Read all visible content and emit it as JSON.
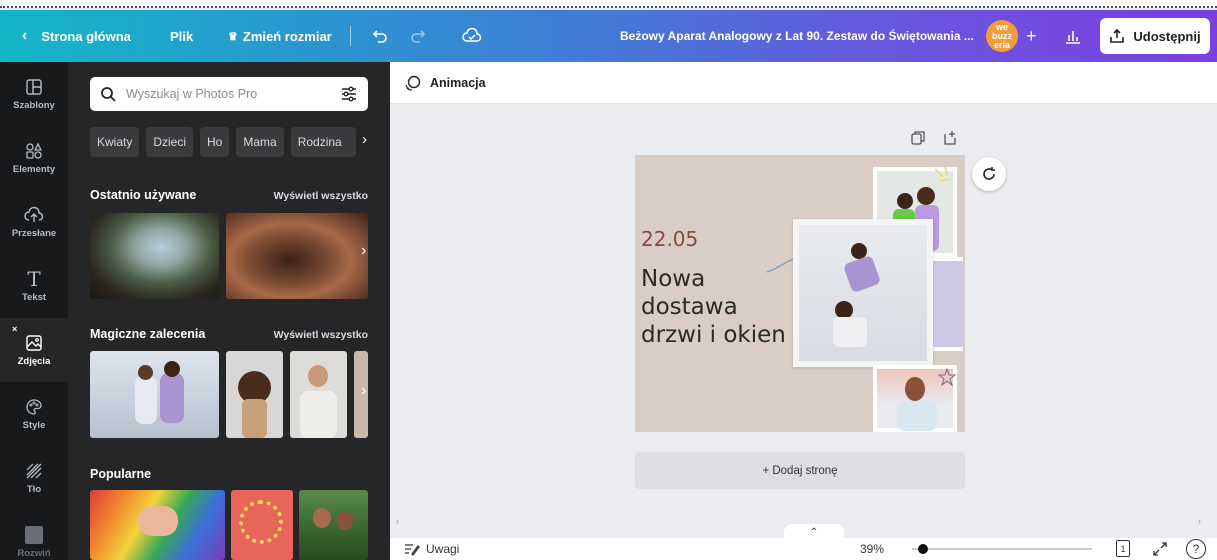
{
  "topbar": {
    "home_label": "Strona główna",
    "file_label": "Plik",
    "resize_label": "Zmień rozmiar",
    "doc_title": "Beżowy Aparat Analogowy z Lat 90. Zestaw do Świętowania ...",
    "share_label": "Udostępnij",
    "avatar_text": "we buzz eria"
  },
  "rail": {
    "items": [
      {
        "label": "Szablony",
        "icon": "templates-icon"
      },
      {
        "label": "Elementy",
        "icon": "elements-icon"
      },
      {
        "label": "Przesłane",
        "icon": "upload-icon"
      },
      {
        "label": "Tekst",
        "icon": "text-icon"
      },
      {
        "label": "Zdjęcia",
        "icon": "photos-icon"
      },
      {
        "label": "Style",
        "icon": "styles-icon"
      },
      {
        "label": "Tło",
        "icon": "background-icon"
      },
      {
        "label": "Rozwiń",
        "icon": "more-icon"
      }
    ]
  },
  "panel": {
    "search_placeholder": "Wyszukaj w Photos Pro",
    "chips": [
      "Kwiaty",
      "Dzieci",
      "Ho",
      "Mama",
      "Rodzina"
    ],
    "recent_title": "Ostatnio używane",
    "magic_title": "Magiczne zalecenia",
    "popular_title": "Popularne",
    "see_all": "Wyświetl wszystko"
  },
  "toolbar": {
    "animation_label": "Animacja"
  },
  "design": {
    "date": "22.05",
    "headline_1": "Nowa",
    "headline_2": "dostawa",
    "headline_3": "drzwi i okien"
  },
  "add_page_label": "+ Dodaj stronę",
  "bottom": {
    "notes_label": "Uwagi",
    "zoom": "39%",
    "page_count": "1"
  },
  "colors": {
    "gradient_start": "#13b6c8",
    "gradient_end": "#7b3fe0",
    "date_color": "#8a4a3d",
    "design_bg": "#d9cdc6"
  }
}
